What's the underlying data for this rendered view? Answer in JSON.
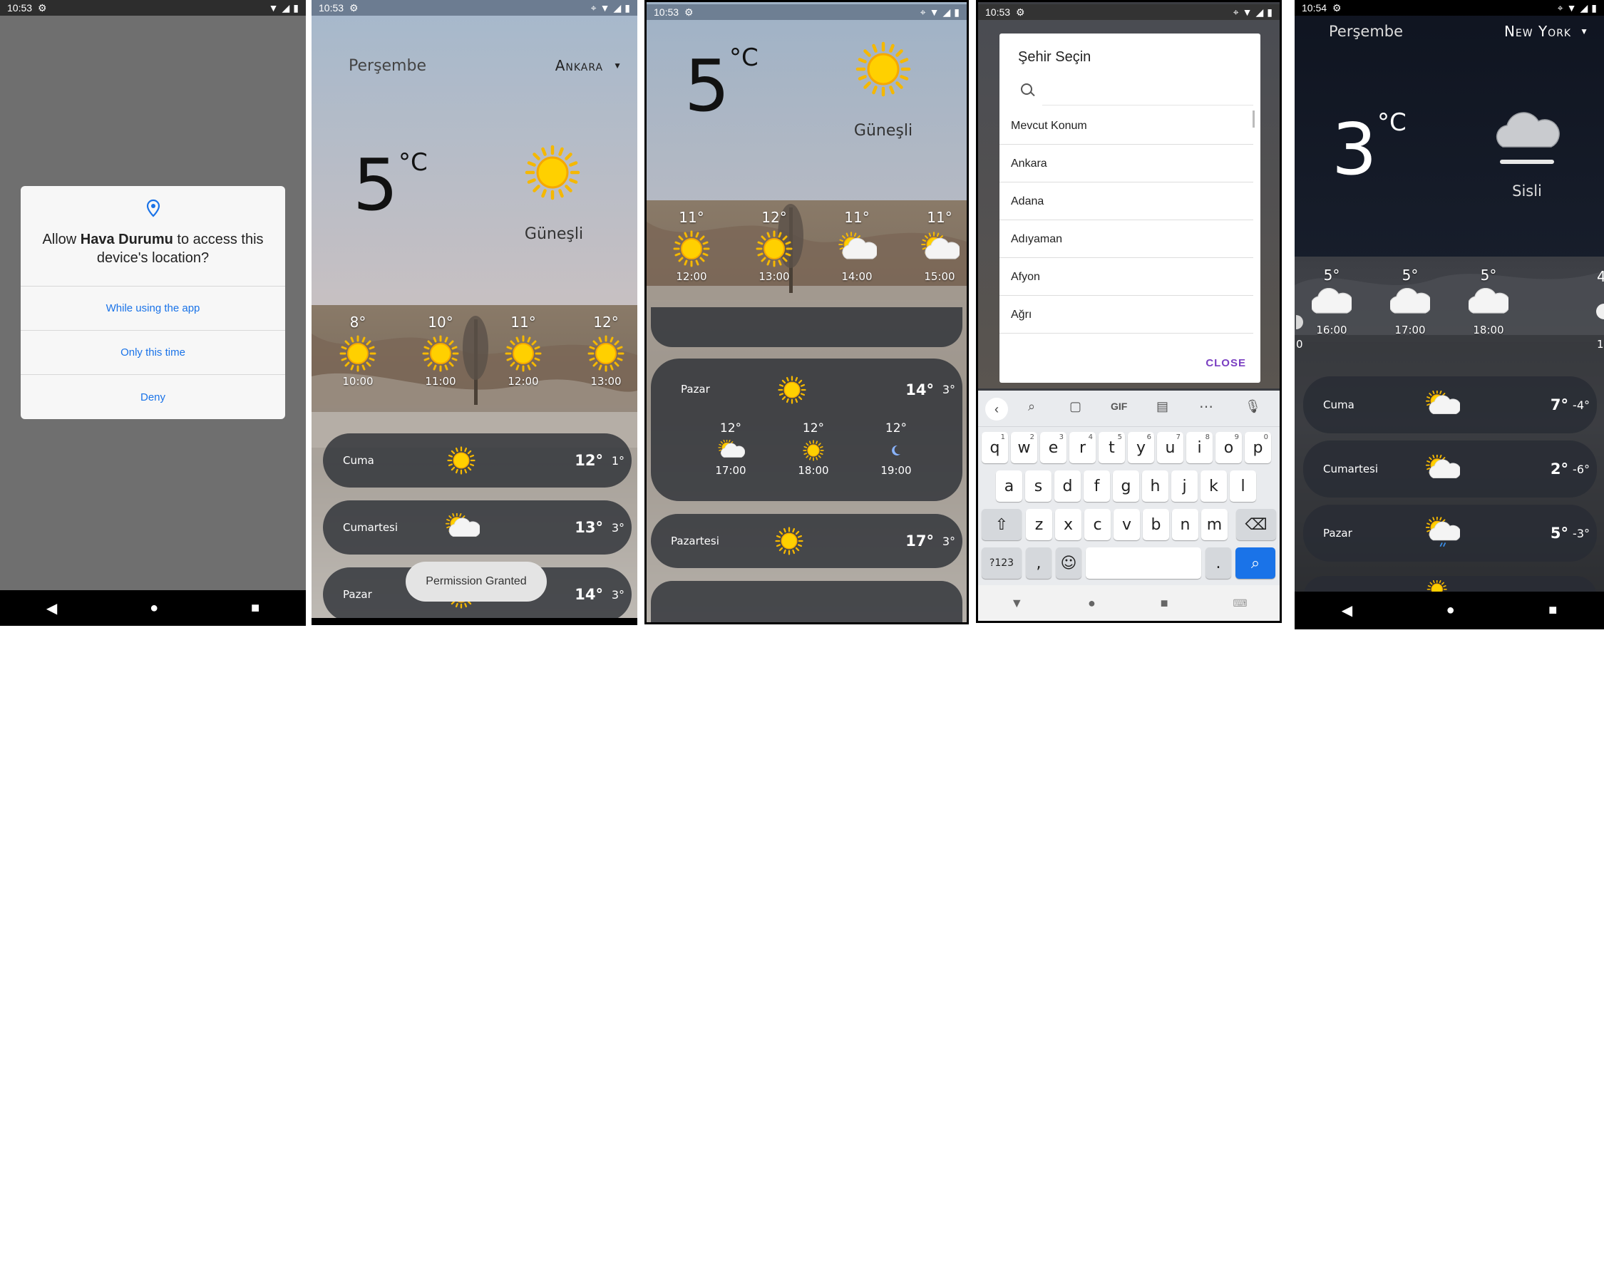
{
  "screen1": {
    "status_time": "10:53",
    "dialog": {
      "title_pre": "Allow ",
      "title_app": "Hava Durumu",
      "title_post": " to access this device's location?",
      "btn_while": "While using the app",
      "btn_once": "Only this time",
      "btn_deny": "Deny"
    }
  },
  "screen2": {
    "status_time": "10:53",
    "day": "Perşembe",
    "city": "Ankara",
    "temp": "5",
    "unit": "°C",
    "condition": "Güneşli",
    "hourly": [
      {
        "temp": "8°",
        "time": "10:00"
      },
      {
        "temp": "10°",
        "time": "11:00"
      },
      {
        "temp": "11°",
        "time": "12:00"
      },
      {
        "temp": "12°",
        "time": "13:00"
      }
    ],
    "daily": [
      {
        "day": "Cuma",
        "hi": "12°",
        "lo": "1°"
      },
      {
        "day": "Cumartesi",
        "hi": "13°",
        "lo": "3°"
      },
      {
        "day": "Pazar",
        "hi": "14°",
        "lo": "3°"
      }
    ],
    "toast": "Permission Granted"
  },
  "screen3": {
    "status_time": "10:53",
    "temp": "5",
    "unit": "°C",
    "condition": "Güneşli",
    "hourly": [
      {
        "temp": "11°",
        "time": "12:00"
      },
      {
        "temp": "12°",
        "time": "13:00"
      },
      {
        "temp": "11°",
        "time": "14:00"
      },
      {
        "temp": "11°",
        "time": "15:00"
      }
    ],
    "expanded": {
      "day": "Pazar",
      "hi": "14°",
      "lo": "3°",
      "hours": [
        {
          "temp": "12°",
          "time": "17:00"
        },
        {
          "temp": "12°",
          "time": "18:00"
        },
        {
          "temp": "12°",
          "time": "19:00"
        }
      ]
    },
    "next": {
      "day": "Pazartesi",
      "hi": "17°",
      "lo": "3°"
    }
  },
  "screen4": {
    "status_time": "10:53",
    "dialog_title": "Şehir Seçin",
    "cities": [
      "Mevcut Konum",
      "Ankara",
      "Adana",
      "Adıyaman",
      "Afyon",
      "Ağrı"
    ],
    "close": "CLOSE",
    "kb_toolbar_gif": "GIF",
    "row1": [
      {
        "k": "q",
        "n": "1"
      },
      {
        "k": "w",
        "n": "2"
      },
      {
        "k": "e",
        "n": "3"
      },
      {
        "k": "r",
        "n": "4"
      },
      {
        "k": "t",
        "n": "5"
      },
      {
        "k": "y",
        "n": "6"
      },
      {
        "k": "u",
        "n": "7"
      },
      {
        "k": "i",
        "n": "8"
      },
      {
        "k": "o",
        "n": "9"
      },
      {
        "k": "p",
        "n": "0"
      }
    ],
    "row2": [
      "a",
      "s",
      "d",
      "f",
      "g",
      "h",
      "j",
      "k",
      "l"
    ],
    "row3": [
      "z",
      "x",
      "c",
      "v",
      "b",
      "n",
      "m"
    ],
    "sym": "?123",
    "comma": ",",
    "period": "."
  },
  "screen5": {
    "status_time": "10:54",
    "day": "Perşembe",
    "city": "New York",
    "temp": "3",
    "unit": "°C",
    "condition": "Sisli",
    "hourly": [
      {
        "temp": "5°",
        "time": "16:00"
      },
      {
        "temp": "5°",
        "time": "17:00"
      },
      {
        "temp": "5°",
        "time": "18:00"
      }
    ],
    "edge_left_time": "0",
    "edge_right_temp": "4",
    "edge_right_time": "1",
    "daily": [
      {
        "day": "Cuma",
        "hi": "7°",
        "lo": "-4°"
      },
      {
        "day": "Cumartesi",
        "hi": "2°",
        "lo": "-6°"
      },
      {
        "day": "Pazar",
        "hi": "5°",
        "lo": "-3°"
      }
    ]
  }
}
